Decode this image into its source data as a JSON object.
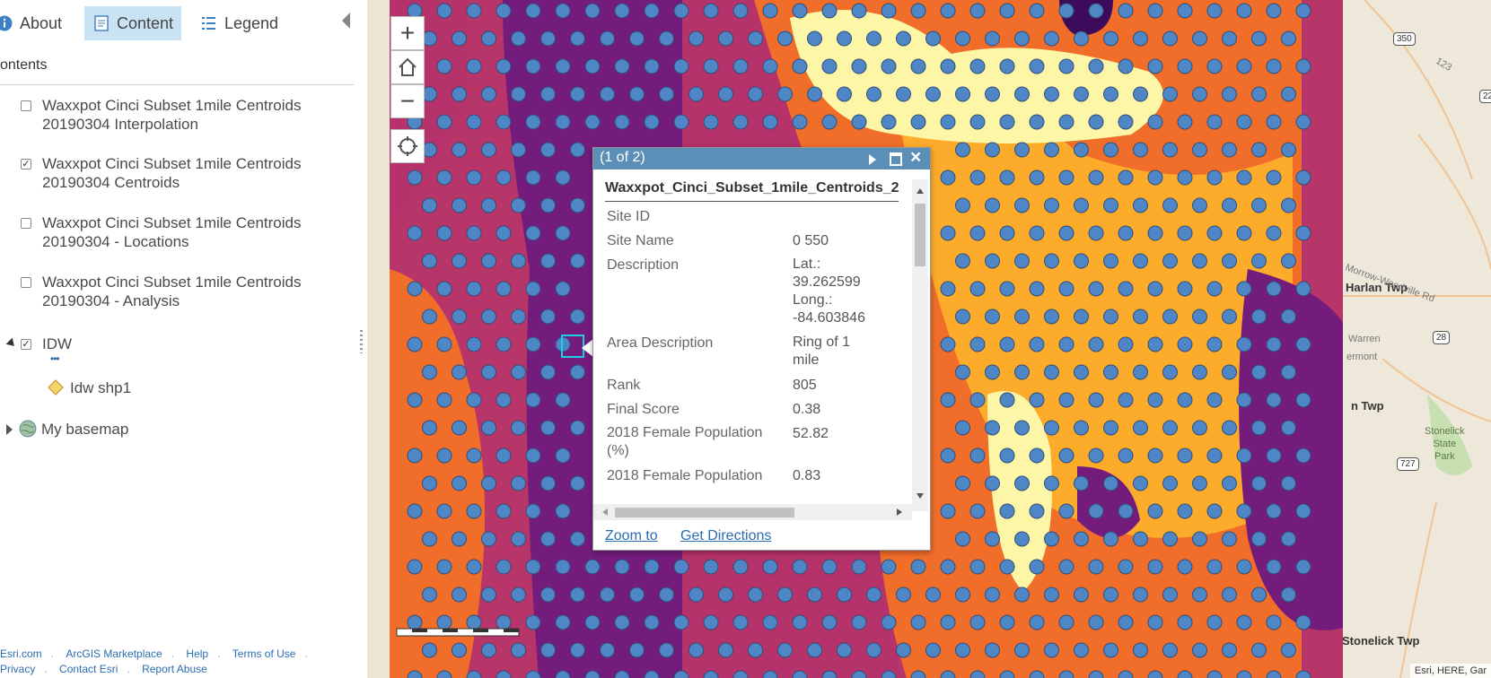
{
  "tabs": [
    {
      "label": "About",
      "icon": "info-icon",
      "active": false
    },
    {
      "label": "Content",
      "icon": "content-icon",
      "active": true
    },
    {
      "label": "Legend",
      "icon": "legend-icon",
      "active": false
    }
  ],
  "contents_title": "ontents",
  "layers": [
    {
      "line1": "Waxxpot Cinci Subset 1mile Centroids",
      "line2": "20190304 Interpolation",
      "checked": false
    },
    {
      "line1": "Waxxpot Cinci Subset 1mile Centroids",
      "line2": "20190304 Centroids",
      "checked": true
    },
    {
      "line1": "Waxxpot Cinci Subset 1mile Centroids",
      "line2": "20190304 - Locations",
      "checked": false
    },
    {
      "line1": "Waxxpot Cinci Subset 1mile Centroids",
      "line2": "20190304 - Analysis",
      "checked": false
    }
  ],
  "idw": {
    "label": "IDW",
    "checked": true,
    "more": "•••",
    "sublayer": "Idw shp1"
  },
  "basemap": {
    "label": "My basemap"
  },
  "footer": {
    "row1": [
      "Esri.com",
      "ArcGIS Marketplace",
      "Help",
      "Terms of Use"
    ],
    "row2": [
      "Privacy",
      "Contact Esri",
      "Report Abuse"
    ]
  },
  "map_controls": {
    "zoom_in": "+",
    "zoom_out": "−"
  },
  "popup": {
    "counter": "(1 of 2)",
    "title": "Waxxpot_Cinci_Subset_1mile_Centroids_2",
    "fields": [
      {
        "name": "Site ID",
        "value": ""
      },
      {
        "name": "Site Name",
        "value": "0 550"
      },
      {
        "name": "Description",
        "value": "Lat.:\n39.262599\nLong.:\n-84.603846"
      },
      {
        "name": "Area Description",
        "value": "Ring of 1\nmile"
      },
      {
        "name": "Rank",
        "value": "805"
      },
      {
        "name": "Final Score",
        "value": "0.38"
      },
      {
        "name": "2018 Female Population (%)",
        "value": "52.82"
      },
      {
        "name": "2018 Female Population",
        "value": "0.83"
      }
    ],
    "zoom_to": "Zoom to",
    "get_directions": "Get Directions"
  },
  "map_labels": {
    "harlan": "Harlan Twp",
    "twp": "n Twp",
    "stonelick": "Stonelick Twp",
    "park": "Stonelick\nState\nPark",
    "warren": "Warren",
    "vermont": "ermont",
    "morrow": "Morrow-Woodville Rd",
    "route350": "350",
    "route28": "28",
    "route727": "727",
    "route22": "22",
    "road123": "123"
  },
  "attribution": "Esri, HERE, Gar"
}
